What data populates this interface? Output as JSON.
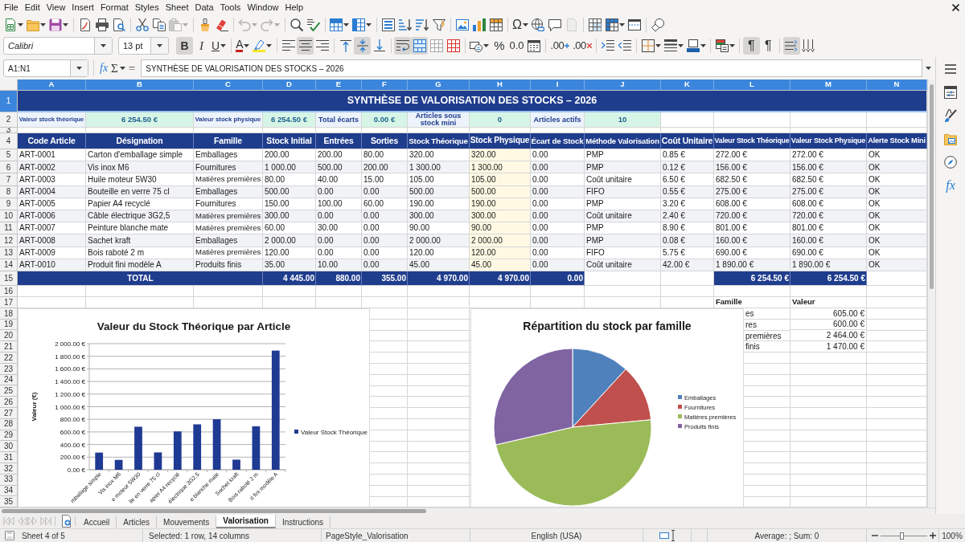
{
  "menu_bar": {
    "items": [
      "File",
      "Edit",
      "View",
      "Insert",
      "Format",
      "Styles",
      "Sheet",
      "Data",
      "Tools",
      "Window",
      "Help"
    ]
  },
  "standard_toolbar": [
    {
      "kind": "new",
      "disabled": false
    },
    {
      "kind": "open",
      "disabled": false
    },
    {
      "kind": "save",
      "disabled": false
    },
    {
      "kind": "export_pdf",
      "disabled": false
    },
    {
      "kind": "print",
      "disabled": false
    },
    {
      "kind": "print_preview",
      "disabled": false
    },
    {
      "kind": "cut",
      "disabled": false
    },
    {
      "kind": "copy",
      "disabled": false
    },
    {
      "kind": "paste",
      "disabled": true
    },
    {
      "kind": "clone",
      "disabled": false
    },
    {
      "kind": "clear",
      "disabled": false
    },
    {
      "kind": "undo",
      "disabled": true
    },
    {
      "kind": "redo",
      "disabled": true
    },
    {
      "kind": "find",
      "disabled": false
    },
    {
      "kind": "spelling",
      "disabled": false
    },
    {
      "kind": "rows",
      "disabled": false
    },
    {
      "kind": "columns",
      "disabled": false
    },
    {
      "kind": "sort",
      "disabled": false
    },
    {
      "kind": "sort_ascending",
      "disabled": false
    },
    {
      "kind": "sort_descending",
      "disabled": false
    },
    {
      "kind": "autofilter",
      "disabled": false
    },
    {
      "kind": "image",
      "disabled": false
    },
    {
      "kind": "chart",
      "disabled": false
    },
    {
      "kind": "pivot",
      "disabled": false
    },
    {
      "kind": "special_character",
      "label": "Ω",
      "disabled": false
    },
    {
      "kind": "hyperlink",
      "disabled": false
    },
    {
      "kind": "comment",
      "disabled": false
    },
    {
      "kind": "header_footer",
      "disabled": true
    },
    {
      "kind": "print_area",
      "disabled": false
    },
    {
      "kind": "freeze",
      "disabled": false
    },
    {
      "kind": "split",
      "disabled": false
    },
    {
      "kind": "draw",
      "disabled": false
    }
  ],
  "formatting_toolbar": {
    "font_name": "Calibri",
    "font_size": "13 pt",
    "buttons": [
      {
        "kind": "bold",
        "label": "B",
        "on": true
      },
      {
        "kind": "italic",
        "label": "I",
        "on": false
      },
      {
        "kind": "underline",
        "label": "U",
        "on": false
      },
      {
        "kind": "font_color",
        "label": "A",
        "on": false
      },
      {
        "kind": "highlight",
        "on": false
      },
      {
        "kind": "align_left",
        "on": false
      },
      {
        "kind": "align_center",
        "on": true
      },
      {
        "kind": "align_right",
        "on": false
      },
      {
        "kind": "align_top",
        "on": false
      },
      {
        "kind": "align_middle",
        "on": true
      },
      {
        "kind": "align_bottom",
        "on": false
      },
      {
        "kind": "wrap",
        "on": true
      },
      {
        "kind": "merge_center",
        "on": true
      },
      {
        "kind": "merge",
        "on": false
      },
      {
        "kind": "unmerge",
        "on": false
      },
      {
        "kind": "currency",
        "on": false
      },
      {
        "kind": "percent",
        "label": "%",
        "on": false
      },
      {
        "kind": "number",
        "label": "0.0",
        "on": false
      },
      {
        "kind": "date",
        "on": false
      },
      {
        "kind": "add_decimal",
        "label": ".00",
        "on": false
      },
      {
        "kind": "delete_decimal",
        "label": ".00",
        "on": false
      },
      {
        "kind": "indent_increase",
        "on": false
      },
      {
        "kind": "indent_decrease",
        "on": false
      },
      {
        "kind": "borders",
        "on": false
      },
      {
        "kind": "border_style",
        "on": false
      },
      {
        "kind": "border_color",
        "on": false
      },
      {
        "kind": "conditional",
        "on": false
      },
      {
        "kind": "ltr",
        "label": "¶",
        "on": true
      },
      {
        "kind": "rtl",
        "label": "¶",
        "on": false
      },
      {
        "kind": "text_horizontal",
        "on": true
      },
      {
        "kind": "text_vertical",
        "on": false
      }
    ]
  },
  "formula_bar": {
    "name_box": "A1:N1",
    "function_wizard": "fx",
    "sum": "Σ",
    "equals": "=",
    "content": "SYNTHÈSE DE VALORISATION DES STOCKS – 2026"
  },
  "sheet": {
    "column_headers": [
      {
        "label": "A",
        "selected": true
      },
      {
        "label": "B",
        "selected": true
      },
      {
        "label": "C",
        "selected": true
      },
      {
        "label": "D",
        "selected": true
      },
      {
        "label": "E",
        "selected": true
      },
      {
        "label": "F",
        "selected": true
      },
      {
        "label": "G",
        "selected": true
      },
      {
        "label": "H",
        "selected": true
      },
      {
        "label": "I",
        "selected": true
      },
      {
        "label": "J",
        "selected": true
      },
      {
        "label": "K",
        "selected": true
      },
      {
        "label": "L",
        "selected": true
      },
      {
        "label": "M",
        "selected": true
      },
      {
        "label": "N",
        "selected": true
      }
    ],
    "row_headers": [
      {
        "label": "1",
        "selected": true
      },
      {
        "label": "2",
        "selected": false
      },
      {
        "label": "3",
        "selected": false
      },
      {
        "label": "4",
        "selected": false
      },
      {
        "label": "5",
        "selected": false
      },
      {
        "label": "6",
        "selected": false
      },
      {
        "label": "7",
        "selected": false
      },
      {
        "label": "8",
        "selected": false
      },
      {
        "label": "9",
        "selected": false
      },
      {
        "label": "10",
        "selected": false
      },
      {
        "label": "11",
        "selected": false
      },
      {
        "label": "12",
        "selected": false
      },
      {
        "label": "13",
        "selected": false
      },
      {
        "label": "14",
        "selected": false
      },
      {
        "label": "15",
        "selected": false
      },
      {
        "label": "16",
        "selected": false
      },
      {
        "label": "17",
        "selected": false
      },
      {
        "label": "18",
        "selected": false
      },
      {
        "label": "19",
        "selected": false
      },
      {
        "label": "20",
        "selected": false
      },
      {
        "label": "21",
        "selected": false
      },
      {
        "label": "22",
        "selected": false
      },
      {
        "label": "23",
        "selected": false
      },
      {
        "label": "24",
        "selected": false
      },
      {
        "label": "25",
        "selected": false
      },
      {
        "label": "26",
        "selected": false
      },
      {
        "label": "27",
        "selected": false
      },
      {
        "label": "28",
        "selected": false
      },
      {
        "label": "29",
        "selected": false
      },
      {
        "label": "30",
        "selected": false
      },
      {
        "label": "31",
        "selected": false
      },
      {
        "label": "32",
        "selected": false
      },
      {
        "label": "33",
        "selected": false
      },
      {
        "label": "34",
        "selected": false
      },
      {
        "label": "35",
        "selected": false
      }
    ],
    "title": "SYNTHÈSE DE VALORISATION DES STOCKS – 2026",
    "summary": [
      {
        "label": "Valeur stock théorique",
        "value": "6 254.50 €"
      },
      {
        "label": "Valeur stock physique",
        "value": "6 254.50 €"
      },
      {
        "label": "Total écarts",
        "value": "0.00 €"
      },
      {
        "label": "Articles sous stock mini",
        "value": "0"
      },
      {
        "label": "Articles actifs",
        "value": "10"
      }
    ],
    "table": {
      "columns": [
        "Code Article",
        "Désignation",
        "Famille",
        "Stock Initial",
        "Entrées",
        "Sorties",
        "Stock Théorique",
        "Stock Physique",
        "Écart de Stock",
        "Méthode Valorisation",
        "Coût Unitaire",
        "Valeur Stock Théorique",
        "Valeur Stock Physique",
        "Alerte Stock Mini"
      ],
      "rows": [
        [
          "ART-0001",
          "Carton d'emballage simple",
          "Emballages",
          "200.00",
          "200.00",
          "80.00",
          "320.00",
          "320.00",
          "0.00",
          "PMP",
          "0.85 €",
          "272.00 €",
          "272.00 €",
          "OK"
        ],
        [
          "ART-0002",
          "Vis inox M6",
          "Fournitures",
          "1 000.00",
          "500.00",
          "200.00",
          "1 300.00",
          "1 300.00",
          "0.00",
          "PMP",
          "0.12 €",
          "156.00 €",
          "156.00 €",
          "OK"
        ],
        [
          "ART-0003",
          "Huile moteur 5W30",
          "Matières premières",
          "80.00",
          "40.00",
          "15.00",
          "105.00",
          "105.00",
          "0.00",
          "Coût unitaire",
          "6.50 €",
          "682.50 €",
          "682.50 €",
          "OK"
        ],
        [
          "ART-0004",
          "Bouteille en verre 75 cl",
          "Emballages",
          "500.00",
          "0.00",
          "0.00",
          "500.00",
          "500.00",
          "0.00",
          "FIFO",
          "0.55 €",
          "275.00 €",
          "275.00 €",
          "OK"
        ],
        [
          "ART-0005",
          "Papier A4 recyclé",
          "Fournitures",
          "150.00",
          "100.00",
          "60.00",
          "190.00",
          "190.00",
          "0.00",
          "PMP",
          "3.20 €",
          "608.00 €",
          "608.00 €",
          "OK"
        ],
        [
          "ART-0006",
          "Câble électrique 3G2,5",
          "Matières premières",
          "300.00",
          "0.00",
          "0.00",
          "300.00",
          "300.00",
          "0.00",
          "Coût unitaire",
          "2.40 €",
          "720.00 €",
          "720.00 €",
          "OK"
        ],
        [
          "ART-0007",
          "Peinture blanche mate",
          "Matières premières",
          "60.00",
          "30.00",
          "0.00",
          "90.00",
          "90.00",
          "0.00",
          "PMP",
          "8.90 €",
          "801.00 €",
          "801.00 €",
          "OK"
        ],
        [
          "ART-0008",
          "Sachet kraft",
          "Emballages",
          "2 000.00",
          "0.00",
          "0.00",
          "2 000.00",
          "2 000.00",
          "0.00",
          "PMP",
          "0.08 €",
          "160.00 €",
          "160.00 €",
          "OK"
        ],
        [
          "ART-0009",
          "Bois raboté 2 m",
          "Matières premières",
          "120.00",
          "0.00",
          "0.00",
          "120.00",
          "120.00",
          "0.00",
          "FIFO",
          "5.75 €",
          "690.00 €",
          "690.00 €",
          "OK"
        ],
        [
          "ART-0010",
          "Produit fini modèle A",
          "Produits finis",
          "35.00",
          "10.00",
          "0.00",
          "45.00",
          "45.00",
          "0.00",
          "Coût unitaire",
          "42.00 €",
          "1 890.00 €",
          "1 890.00 €",
          "OK"
        ]
      ],
      "totals": {
        "label": "TOTAL",
        "quantities": [
          "4 445.00",
          "880.00",
          "355.00",
          "4 970.00",
          "4 970.00",
          "0.00"
        ],
        "values": [
          "6 254.50 €",
          "6 254.50 €"
        ]
      }
    },
    "family_summary": {
      "columns": [
        "Famille",
        "Valeur"
      ],
      "rows": [
        {
          "family": "es",
          "value": "605.00 €"
        },
        {
          "family": "res",
          "value": "600.00 €"
        },
        {
          "family": "premières",
          "value": "2 464.00 €"
        },
        {
          "family": "finis",
          "value": "1 470.00 €"
        }
      ]
    },
    "charts": [
      {
        "chart_data": {
          "type": "bar",
          "title": "Valeur du Stock Théorique par Article",
          "ylabel": "Valeur (€)",
          "categories": [
            "mballage simple",
            "Vis inox M6",
            "e moteur 5W30",
            "lle en verre 75 cl",
            "apier A4 recyclé",
            "électrique 3G2,5",
            "e blanche mate",
            "Sachet kraft",
            "Bois raboté 2 m",
            "it fini modèle A"
          ],
          "series": [
            {
              "name": "Valeur Stock Théorique",
              "color": "#1f3a93",
              "values": [
                272,
                156,
                682.5,
                275,
                608,
                720,
                801,
                160,
                690,
                1890
              ]
            }
          ],
          "ylim": [
            0,
            2000
          ],
          "yticks": [
            {
              "value": 0,
              "label": "0.00 €"
            },
            {
              "value": 200,
              "label": "200.00 €"
            },
            {
              "value": 400,
              "label": "400.00 €"
            },
            {
              "value": 600,
              "label": "600.00 €"
            },
            {
              "value": 800,
              "label": "800.00 €"
            },
            {
              "value": 1000,
              "label": "1 000.00 €"
            },
            {
              "value": 1200,
              "label": "1 200.00 €"
            },
            {
              "value": 1400,
              "label": "1 400.00 €"
            },
            {
              "value": 1600,
              "label": "1 600.00 €"
            },
            {
              "value": 1800,
              "label": "1 800.00 €"
            },
            {
              "value": 2000,
              "label": "2 000.00 €"
            }
          ],
          "grid": true,
          "legend": "right"
        }
      },
      {
        "chart_data": {
          "type": "pie",
          "title": "Répartition du stock par famille",
          "categories": [
            "Emballages",
            "Fournitures",
            "Matières premières",
            "Produits finis"
          ],
          "values": [
            11.8,
            11.7,
            47.9,
            28.6
          ],
          "colors": [
            "#4f81bd",
            "#c0504d",
            "#9bbb59",
            "#8064a2"
          ],
          "legend": "right"
        }
      }
    ]
  },
  "sidebar": {
    "buttons": [
      {
        "kind": "properties"
      },
      {
        "kind": "styles"
      },
      {
        "kind": "gallery"
      },
      {
        "kind": "navigator"
      },
      {
        "kind": "functions",
        "label": "fx"
      }
    ]
  },
  "sheet_tabs": {
    "navigation": [
      {
        "kind": "first",
        "disabled": true
      },
      {
        "kind": "previous",
        "disabled": true
      },
      {
        "kind": "next",
        "disabled": true
      },
      {
        "kind": "last",
        "disabled": true
      }
    ],
    "tabs": [
      {
        "label": "Accueil",
        "selected": false
      },
      {
        "label": "Articles",
        "selected": false
      },
      {
        "label": "Mouvements",
        "selected": false
      },
      {
        "label": "Valorisation",
        "selected": true
      },
      {
        "label": "Instructions",
        "selected": false
      }
    ]
  },
  "status_bar": {
    "sheet_position": "Sheet 4 of 5",
    "selection": "Selected: 1 row, 14 columns",
    "page_style": "PageStyle_Valorisation",
    "language": "English (USA)",
    "summary": "Average: ; Sum: 0",
    "zoom": {
      "level": 0.45,
      "label": "100%"
    }
  }
}
